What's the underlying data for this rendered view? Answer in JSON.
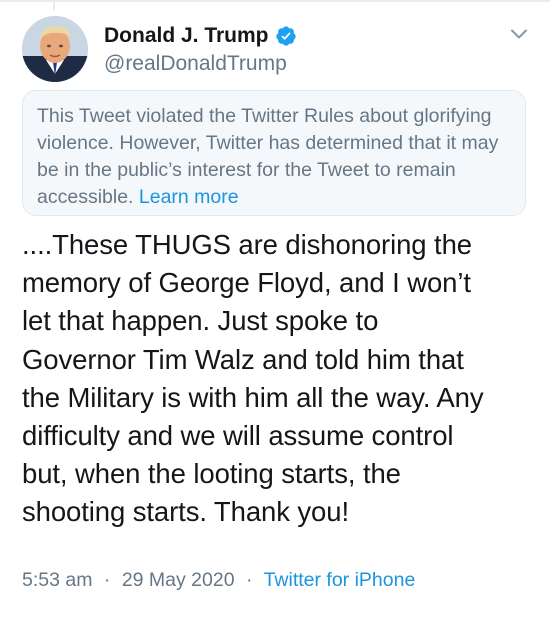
{
  "tweet": {
    "author": {
      "display_name": "Donald J. Trump",
      "handle": "@realDonaldTrump",
      "verified": true,
      "avatar_icon": "profile-photo"
    },
    "notice": {
      "text": "This Tweet violated the Twitter Rules about glorifying violence. However, Twitter has determined that it may be in the public’s interest for the Tweet to remain accessible.",
      "link_label": "Learn more"
    },
    "body_lines": [
      "....These THUGS are dishonoring the",
      "memory of George Floyd, and I won’t",
      "let that happen. Just spoke to",
      "Governor Tim Walz and told him that",
      "the Military is with him all the way. Any",
      "difficulty and we will assume control",
      "but, when the looting starts, the",
      "shooting starts. Thank you!"
    ],
    "time": "5:53 am",
    "separator": "·",
    "date": "29 May 2020",
    "source": "Twitter for iPhone"
  },
  "colors": {
    "text_primary": "#14171a",
    "text_secondary": "#657786",
    "link": "#1b95e0",
    "verified_badge": "#1da1f2",
    "notice_bg": "#f5f8fa"
  }
}
